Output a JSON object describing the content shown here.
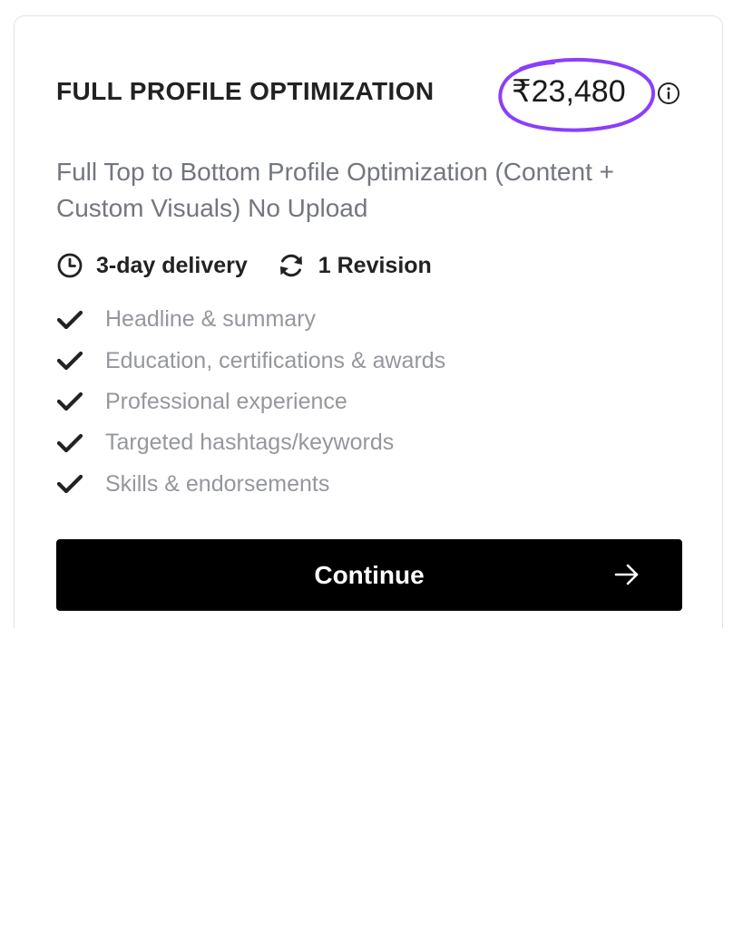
{
  "package": {
    "title": "FULL PROFILE OPTIMIZATION",
    "price": "₹23,480",
    "description": "Full Top to Bottom Profile Optimization (Content + Custom Visuals) No Upload",
    "delivery": "3-day delivery",
    "revisions": "1 Revision",
    "features": [
      "Headline & summary",
      "Education, certifications & awards",
      "Professional experience",
      "Targeted hashtags/keywords",
      "Skills & endorsements"
    ],
    "continue_label": "Continue"
  },
  "icons": {
    "info": "info-icon",
    "clock": "clock-icon",
    "revision": "refresh-icon",
    "check": "check-icon",
    "arrow": "arrow-right-icon"
  },
  "colors": {
    "highlight_circle": "#8a3ffc",
    "button_bg": "#000000",
    "feature_text": "#95979d",
    "description_text": "#74767e"
  }
}
